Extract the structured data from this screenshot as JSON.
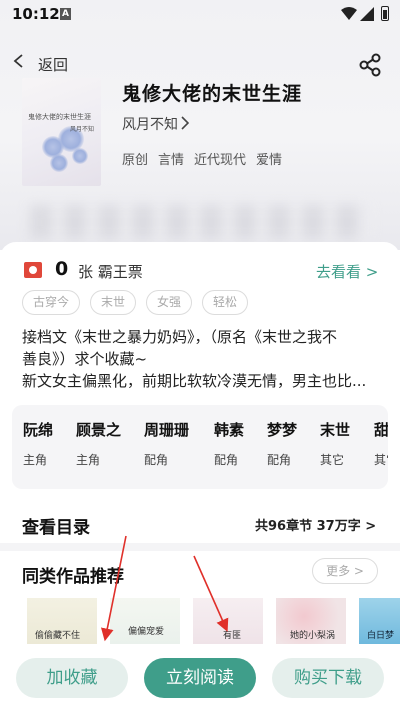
{
  "status_bar": {
    "time": "10:12",
    "notification_icon": "A"
  },
  "nav": {
    "back_label": "返回"
  },
  "book": {
    "title": "鬼修大佬的末世生涯",
    "author": "风月不知",
    "tags": [
      "原创",
      "言情",
      "近代现代",
      "爱情"
    ],
    "cover_title": "鬼修大佬的末世生涯",
    "cover_author": "风月不知"
  },
  "tickets": {
    "count": "0",
    "label": "张 霸王票",
    "go_see": "去看看 >"
  },
  "chips": [
    "古穿今",
    "末世",
    "女强",
    "轻松"
  ],
  "description": [
    "接档文《末世之暴力奶妈》，（原名《末世之我不",
    "善良》）求个收藏~",
    "新文女主偏黑化，前期比软软冷漠无情，男主也比..."
  ],
  "roles": [
    {
      "name": "阮绵",
      "role": "主角"
    },
    {
      "name": "顾景之",
      "role": "主角"
    },
    {
      "name": "周珊珊",
      "role": "配角"
    },
    {
      "name": "韩素",
      "role": "配角"
    },
    {
      "name": "梦梦",
      "role": "配角"
    },
    {
      "name": "末世",
      "role": "其它"
    },
    {
      "name": "甜",
      "role": "其它"
    }
  ],
  "catalog": {
    "title": "查看目录",
    "info": "共96章节 37万字 >"
  },
  "similar": {
    "title": "同类作品推荐",
    "more": "更多 >"
  },
  "recommendations": [
    {
      "title": "偷偷藏不住"
    },
    {
      "title": "偏偏宠爱"
    },
    {
      "title": "有匪"
    },
    {
      "title": "她的小梨涡"
    },
    {
      "title": "白日梦"
    }
  ],
  "bottom": {
    "collect": "加收藏",
    "read": "立刻阅读",
    "buy": "购买下载"
  },
  "colors": {
    "accent": "#3f9e8a",
    "accent_light": "#e5efec",
    "annotation": "#e0302a",
    "ticket": "#e0473a"
  }
}
